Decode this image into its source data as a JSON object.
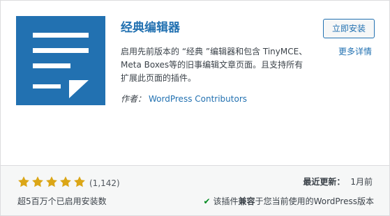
{
  "plugin": {
    "name": "经典编辑器",
    "description": "启用先前版本的 “经典 ”编辑器和包含 TinyMCE、Meta Boxes等的旧事编辑文章页面。且支持所有扩展此页面的插件。",
    "authors_label": "作者：",
    "authors_value": "WordPress Contributors",
    "icon": "document-icon",
    "icon_bg_color": "#2271b1"
  },
  "actions": {
    "install_label": "立即安装",
    "more_details_label": "更多详情"
  },
  "footer": {
    "rating_stars": 5,
    "rating_count": "(1,142)",
    "installs_text": "超5百万个已启用安装数",
    "last_updated_label": "最近更新：",
    "last_updated_value": "1月前",
    "compat_before": "该插件",
    "compat_bold": "兼容",
    "compat_after": "于您当前使用的WordPress版本",
    "star_color": "#dba617",
    "check_color": "#008a20"
  }
}
